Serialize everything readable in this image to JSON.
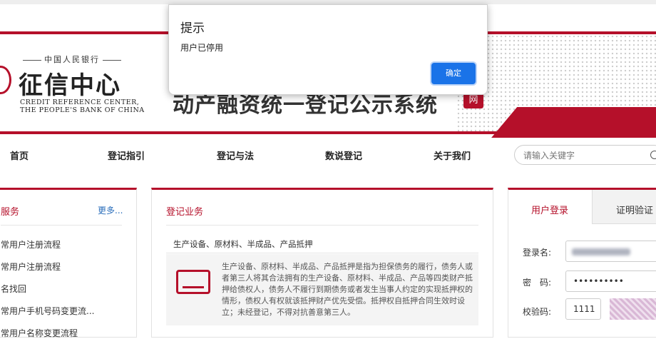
{
  "header": {
    "logo_top": "中国人民银行",
    "logo_main": "征信中心",
    "logo_en_line1": "CREDIT REFERENCE CENTER,",
    "logo_en_line2": "THE PEOPLE'S BANK OF CHINA",
    "system_title": "动产融资统一登记公示系统",
    "system_badge": "网"
  },
  "nav": {
    "items": [
      "首页",
      "登记指引",
      "登记与法",
      "数说登记",
      "关于我们"
    ],
    "search_placeholder": "请输入关键字"
  },
  "left_panel": {
    "title": "服务",
    "more": "更多...",
    "links": [
      "常用户注册流程",
      "常用户注册流程",
      "名找回",
      "常用户手机号码变更流...",
      "常用户名称变更流程"
    ]
  },
  "middle_panel": {
    "title": "登记业务",
    "subtitle": "生产设备、原材料、半成品、产品抵押",
    "description": "生产设备、原材料、半成品、产品抵押是指为担保债务的履行，债务人或者第三人将其合法拥有的生产设备、原材料、半成品、产品等四类财产抵押给债权人，债务人不履行到期债务或者发生当事人约定的实现抵押权的情形，债权人有权就该抵押财产优先受偿。抵押权自抵押合同生效时设立；未经登记，不得对抗善意第三人。"
  },
  "login_panel": {
    "tab_login": "用户登录",
    "tab_cert": "证明验证",
    "username_label": "登录名:",
    "password_label": "密　码:",
    "password_value": "••••••••••",
    "captcha_label": "校验码:",
    "captcha_value": "1111"
  },
  "dialog": {
    "title": "提示",
    "message": "用户已停用",
    "ok_label": "确定"
  }
}
